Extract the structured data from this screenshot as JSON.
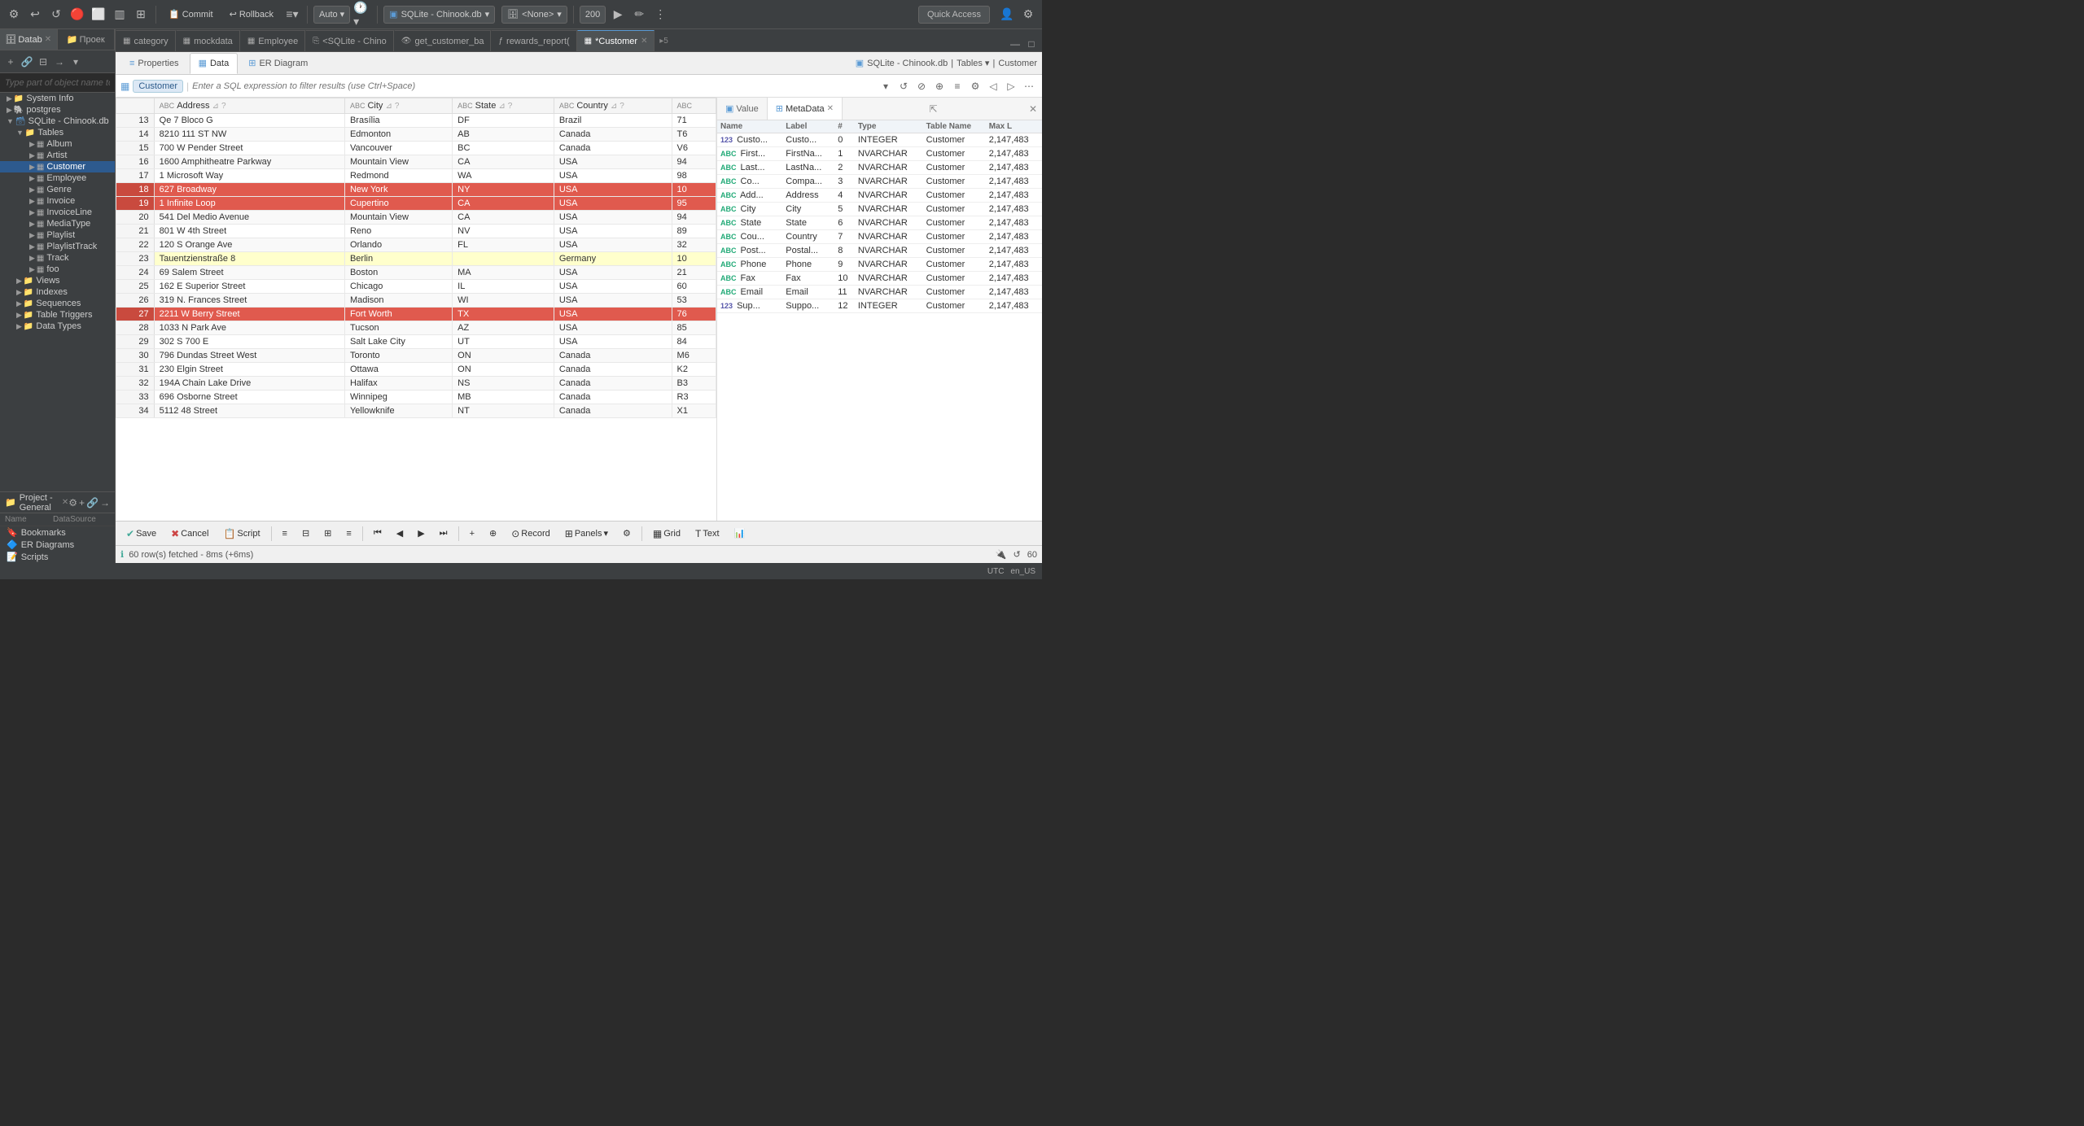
{
  "toolbar": {
    "commit_label": "Commit",
    "rollback_label": "Rollback",
    "auto_label": "Auto",
    "db_label": "SQLite - Chinook.db",
    "none_label": "<None>",
    "limit_value": "200",
    "quick_access_label": "Quick Access"
  },
  "sidebar": {
    "tab1": "Datab",
    "tab2": "Проек",
    "search_placeholder": "Type part of object name to filter",
    "tree": [
      {
        "label": "System Info",
        "icon": "folder",
        "depth": 1
      },
      {
        "label": "postgres",
        "icon": "db",
        "depth": 1
      },
      {
        "label": "SQLite - Chinook.db",
        "icon": "db",
        "depth": 1,
        "expanded": true
      },
      {
        "label": "Tables",
        "icon": "folder",
        "depth": 2,
        "expanded": true
      },
      {
        "label": "Album",
        "icon": "table",
        "depth": 3
      },
      {
        "label": "Artist",
        "icon": "table",
        "depth": 3
      },
      {
        "label": "Customer",
        "icon": "table",
        "depth": 3,
        "selected": true
      },
      {
        "label": "Employee",
        "icon": "table",
        "depth": 3
      },
      {
        "label": "Genre",
        "icon": "table",
        "depth": 3
      },
      {
        "label": "Invoice",
        "icon": "table",
        "depth": 3
      },
      {
        "label": "InvoiceLine",
        "icon": "table",
        "depth": 3
      },
      {
        "label": "MediaType",
        "icon": "table",
        "depth": 3
      },
      {
        "label": "Playlist",
        "icon": "table",
        "depth": 3
      },
      {
        "label": "PlaylistTrack",
        "icon": "table",
        "depth": 3
      },
      {
        "label": "Track",
        "icon": "table",
        "depth": 3
      },
      {
        "label": "foo",
        "icon": "table",
        "depth": 3
      },
      {
        "label": "Views",
        "icon": "folder",
        "depth": 2
      },
      {
        "label": "Indexes",
        "icon": "folder",
        "depth": 2
      },
      {
        "label": "Sequences",
        "icon": "folder",
        "depth": 2
      },
      {
        "label": "Table Triggers",
        "icon": "folder",
        "depth": 2
      },
      {
        "label": "Data Types",
        "icon": "folder",
        "depth": 2
      }
    ]
  },
  "project": {
    "title": "Project - General",
    "col_name": "Name",
    "col_ds": "DataSource",
    "items": [
      {
        "label": "Bookmarks",
        "icon": "bookmark"
      },
      {
        "label": "ER Diagrams",
        "icon": "er"
      },
      {
        "label": "Scripts",
        "icon": "script"
      }
    ]
  },
  "editor_tabs": [
    {
      "label": "category",
      "icon": "table",
      "active": false
    },
    {
      "label": "mockdata",
      "icon": "table",
      "active": false
    },
    {
      "label": "Employee",
      "icon": "table",
      "active": false
    },
    {
      "label": "<SQLite - Chino",
      "icon": "sql",
      "active": false
    },
    {
      "label": "get_customer_ba",
      "icon": "view",
      "active": false
    },
    {
      "label": "rewards_report(",
      "icon": "func",
      "active": false
    },
    {
      "label": "*Customer",
      "icon": "table",
      "active": true
    },
    {
      "label": "5",
      "icon": "more",
      "active": false
    }
  ],
  "sub_tabs": [
    {
      "label": "Properties",
      "icon": "props",
      "active": false
    },
    {
      "label": "Data",
      "icon": "data",
      "active": true
    },
    {
      "label": "ER Diagram",
      "icon": "er",
      "active": false
    }
  ],
  "filter_bar": {
    "tag": "Customer",
    "placeholder": "Enter a SQL expression to filter results (use Ctrl+Space)"
  },
  "columns": [
    {
      "name": "Address",
      "type": "ABC"
    },
    {
      "name": "City",
      "type": "ABC"
    },
    {
      "name": "State",
      "type": "ABC"
    },
    {
      "name": "Country",
      "type": "ABC"
    },
    {
      "name": "...",
      "type": ""
    }
  ],
  "rows": [
    {
      "num": 13,
      "address": "Qe 7 Bloco G",
      "city": "Brasília",
      "state": "DF",
      "country": "Brazil",
      "extra": "71",
      "highlighted": false
    },
    {
      "num": 14,
      "address": "8210 111 ST NW",
      "city": "Edmonton",
      "state": "AB",
      "country": "Canada",
      "extra": "T6",
      "highlighted": false
    },
    {
      "num": 15,
      "address": "700 W Pender Street",
      "city": "Vancouver",
      "state": "BC",
      "country": "Canada",
      "extra": "V6",
      "highlighted": false
    },
    {
      "num": 16,
      "address": "1600 Amphitheatre Parkway",
      "city": "Mountain View",
      "state": "CA",
      "country": "USA",
      "extra": "94",
      "highlighted": false
    },
    {
      "num": 17,
      "address": "1 Microsoft Way",
      "city": "Redmond",
      "state": "WA",
      "country": "USA",
      "extra": "98",
      "highlighted": false
    },
    {
      "num": 18,
      "address": "627 Broadway",
      "city": "New York",
      "state": "NY",
      "country": "USA",
      "extra": "10",
      "highlighted": true
    },
    {
      "num": 19,
      "address": "1 Infinite Loop",
      "city": "Cupertino",
      "state": "CA",
      "country": "USA",
      "extra": "95",
      "highlighted": true
    },
    {
      "num": 20,
      "address": "541 Del Medio Avenue",
      "city": "Mountain View",
      "state": "CA",
      "country": "USA",
      "extra": "94",
      "highlighted": false
    },
    {
      "num": 21,
      "address": "801 W 4th Street",
      "city": "Reno",
      "state": "NV",
      "country": "USA",
      "extra": "89",
      "highlighted": false
    },
    {
      "num": 22,
      "address": "120 S Orange Ave",
      "city": "Orlando",
      "state": "FL",
      "country": "USA",
      "extra": "32",
      "highlighted": false
    },
    {
      "num": 23,
      "address": "Tauentzienstraße 8",
      "city": "Berlin",
      "state": "",
      "country": "Germany",
      "extra": "10",
      "highlighted": false,
      "light": true
    },
    {
      "num": 24,
      "address": "69 Salem Street",
      "city": "Boston",
      "state": "MA",
      "country": "USA",
      "extra": "21",
      "highlighted": false,
      "selected": true
    },
    {
      "num": 25,
      "address": "162 E Superior Street",
      "city": "Chicago",
      "state": "IL",
      "country": "USA",
      "extra": "60",
      "highlighted": false
    },
    {
      "num": 26,
      "address": "319 N. Frances Street",
      "city": "Madison",
      "state": "WI",
      "country": "USA",
      "extra": "53",
      "highlighted": false
    },
    {
      "num": 27,
      "address": "2211 W Berry Street",
      "city": "Fort Worth",
      "state": "TX",
      "country": "USA",
      "extra": "76",
      "highlighted": true
    },
    {
      "num": 28,
      "address": "1033 N Park Ave",
      "city": "Tucson",
      "state": "AZ",
      "country": "USA",
      "extra": "85",
      "highlighted": false
    },
    {
      "num": 29,
      "address": "302 S 700 E",
      "city": "Salt Lake City",
      "state": "UT",
      "country": "USA",
      "extra": "84",
      "highlighted": false
    },
    {
      "num": 30,
      "address": "796 Dundas Street West",
      "city": "Toronto",
      "state": "ON",
      "country": "Canada",
      "extra": "M6",
      "highlighted": false
    },
    {
      "num": 31,
      "address": "230 Elgin Street",
      "city": "Ottawa",
      "state": "ON",
      "country": "Canada",
      "extra": "K2",
      "highlighted": false
    },
    {
      "num": 32,
      "address": "194A Chain Lake Drive",
      "city": "Halifax",
      "state": "NS",
      "country": "Canada",
      "extra": "B3",
      "highlighted": false
    },
    {
      "num": 33,
      "address": "696 Osborne Street",
      "city": "Winnipeg",
      "state": "MB",
      "country": "Canada",
      "extra": "R3",
      "highlighted": false
    },
    {
      "num": 34,
      "address": "5112 48 Street",
      "city": "Yellowknife",
      "state": "NT",
      "country": "Canada",
      "extra": "X1",
      "highlighted": false
    }
  ],
  "metadata": {
    "value_tab": "Value",
    "meta_tab": "MetaData",
    "columns": [
      "Name",
      "Label",
      "#",
      "Type",
      "Table Name",
      "Max L"
    ],
    "rows": [
      {
        "badge": "123",
        "name": "Custo...",
        "label": "Custo...",
        "num": 0,
        "type": "INTEGER",
        "table": "Customer",
        "max": "2,147,483"
      },
      {
        "badge": "ABC",
        "name": "First...",
        "label": "FirstNa...",
        "num": 1,
        "type": "NVARCHAR",
        "table": "Customer",
        "max": "2,147,483"
      },
      {
        "badge": "ABC",
        "name": "Last...",
        "label": "LastNa...",
        "num": 2,
        "type": "NVARCHAR",
        "table": "Customer",
        "max": "2,147,483"
      },
      {
        "badge": "ABC",
        "name": "Co...",
        "label": "Compa...",
        "num": 3,
        "type": "NVARCHAR",
        "table": "Customer",
        "max": "2,147,483"
      },
      {
        "badge": "ABC",
        "name": "Add...",
        "label": "Address",
        "num": 4,
        "type": "NVARCHAR",
        "table": "Customer",
        "max": "2,147,483"
      },
      {
        "badge": "ABC",
        "name": "City",
        "label": "City",
        "num": 5,
        "type": "NVARCHAR",
        "table": "Customer",
        "max": "2,147,483"
      },
      {
        "badge": "ABC",
        "name": "State",
        "label": "State",
        "num": 6,
        "type": "NVARCHAR",
        "table": "Customer",
        "max": "2,147,483"
      },
      {
        "badge": "ABC",
        "name": "Cou...",
        "label": "Country",
        "num": 7,
        "type": "NVARCHAR",
        "table": "Customer",
        "max": "2,147,483"
      },
      {
        "badge": "ABC",
        "name": "Post...",
        "label": "Postal...",
        "num": 8,
        "type": "NVARCHAR",
        "table": "Customer",
        "max": "2,147,483"
      },
      {
        "badge": "ABC",
        "name": "Phone",
        "label": "Phone",
        "num": 9,
        "type": "NVARCHAR",
        "table": "Customer",
        "max": "2,147,483"
      },
      {
        "badge": "ABC",
        "name": "Fax",
        "label": "Fax",
        "num": 10,
        "type": "NVARCHAR",
        "table": "Customer",
        "max": "2,147,483"
      },
      {
        "badge": "ABC",
        "name": "Email",
        "label": "Email",
        "num": 11,
        "type": "NVARCHAR",
        "table": "Customer",
        "max": "2,147,483"
      },
      {
        "badge": "123",
        "name": "Sup...",
        "label": "Suppo...",
        "num": 12,
        "type": "INTEGER",
        "table": "Customer",
        "max": "2,147,483"
      }
    ]
  },
  "bottom_toolbar": {
    "save": "Save",
    "cancel": "Cancel",
    "script": "Script",
    "panels": "Panels",
    "grid": "Grid",
    "text": "Text",
    "record": "Record"
  },
  "status_bar": {
    "message": "60 row(s) fetched - 8ms (+6ms)",
    "rows": "60"
  },
  "very_bottom": {
    "utc": "UTC",
    "locale": "en_US"
  }
}
